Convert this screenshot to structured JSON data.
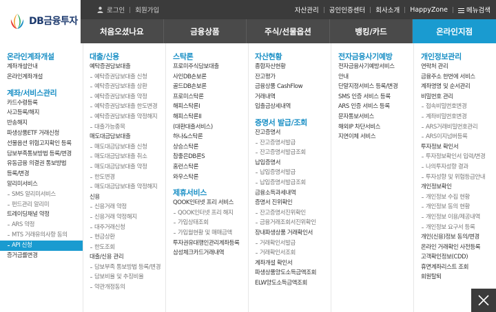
{
  "brand": {
    "name": "DB금융투자",
    "colors": {
      "accent": "#1a9bd0",
      "section": "#1a8fc5",
      "dark": "#3b3b3b",
      "nav": "#4a4a4a"
    }
  },
  "topbar": {
    "login": "로그인",
    "signup": "회원가입",
    "links": [
      "자산관리",
      "공인인증센터",
      "회사소개",
      "HappyZone"
    ],
    "menu_search": "메뉴검색"
  },
  "mainnav": {
    "tabs": [
      "처음오셨나요",
      "금융상품",
      "주식/선물옵션",
      "뱅킹/카드",
      "온라인지점"
    ],
    "active_index": 4
  },
  "columns": [
    {
      "items": [
        {
          "t": "sec",
          "v": "온라인계좌개설"
        },
        {
          "t": "row",
          "v": "계좌개설안내"
        },
        {
          "t": "row",
          "v": "온라인계좌개설"
        },
        {
          "t": "secgap",
          "v": "계좌/서비스관리"
        },
        {
          "t": "row",
          "v": "카드수령등록"
        },
        {
          "t": "row",
          "v": "사고등록/해지"
        },
        {
          "t": "row",
          "v": "반송해지"
        },
        {
          "t": "row",
          "v": "파생상품ETF 거래신청"
        },
        {
          "t": "row",
          "v": "선물옵션 위험고지확인 등록"
        },
        {
          "t": "row",
          "v": "담보부족통보방법 등록/변경"
        },
        {
          "t": "row",
          "v": "유동금융 의결권 통보방법"
        },
        {
          "t": "row",
          "v": "등록/변경"
        },
        {
          "t": "row",
          "v": "알리미서비스"
        },
        {
          "t": "sub",
          "v": "SMS 알리미서비스"
        },
        {
          "t": "sub",
          "v": "펀드관리 알리미"
        },
        {
          "t": "row",
          "v": "트레이딩채널 약정"
        },
        {
          "t": "sub",
          "v": "ARS 약정"
        },
        {
          "t": "sub",
          "v": "MTS 거래유의사항 동의"
        },
        {
          "t": "hl",
          "v": "API 신청"
        },
        {
          "t": "row",
          "v": "증거금률변경"
        }
      ]
    },
    {
      "items": [
        {
          "t": "sec",
          "v": "대출/신용"
        },
        {
          "t": "row",
          "v": "예탁증권담보대출"
        },
        {
          "t": "sub",
          "v": "예탁증권담보대출 신청"
        },
        {
          "t": "sub",
          "v": "예탁증권담보대출 상환"
        },
        {
          "t": "sub",
          "v": "예탁증권담보대출 약정"
        },
        {
          "t": "sub",
          "v": "예탁증권담보대출 한도변경"
        },
        {
          "t": "sub",
          "v": "예탁증권담보대출 약정해지"
        },
        {
          "t": "sub",
          "v": "대출가능종목"
        },
        {
          "t": "row",
          "v": "매도대금담보대출"
        },
        {
          "t": "sub",
          "v": "매도대금담보대출 신청"
        },
        {
          "t": "sub",
          "v": "매도대금담보대출 취소"
        },
        {
          "t": "sub",
          "v": "매도대금담보대출 약정"
        },
        {
          "t": "sub",
          "v": "한도변경"
        },
        {
          "t": "sub",
          "v": "매도대금담보대출 약정해지"
        },
        {
          "t": "row",
          "v": "신용"
        },
        {
          "t": "sub",
          "v": "신용거래 약정"
        },
        {
          "t": "sub",
          "v": "신용거래 약정해지"
        },
        {
          "t": "sub",
          "v": "대주거래신청"
        },
        {
          "t": "sub",
          "v": "현금상환"
        },
        {
          "t": "sub",
          "v": "한도조회"
        },
        {
          "t": "row",
          "v": "대출/신용 관리"
        },
        {
          "t": "sub",
          "v": "담보부족 통보방법 등록/변경"
        },
        {
          "t": "sub",
          "v": "담보비율 및 추징비율"
        },
        {
          "t": "sub",
          "v": "약관개정동의"
        }
      ]
    },
    {
      "items": [
        {
          "t": "sec",
          "v": "스탁론"
        },
        {
          "t": "row",
          "v": "프로미주식담보대출"
        },
        {
          "t": "row",
          "v": "사인DB손보론"
        },
        {
          "t": "row",
          "v": "골드DB손보론"
        },
        {
          "t": "row",
          "v": "프로미스탁론"
        },
        {
          "t": "row",
          "v": "해피스탁론I"
        },
        {
          "t": "row",
          "v": "해피스탁론II"
        },
        {
          "t": "row",
          "v": "(대환대출서비스)"
        },
        {
          "t": "row",
          "v": "하나&스탁론"
        },
        {
          "t": "row",
          "v": "상승스탁론"
        },
        {
          "t": "row",
          "v": "참좋은DB론S"
        },
        {
          "t": "row",
          "v": "홈런스탁론"
        },
        {
          "t": "row",
          "v": "와우스탁론"
        },
        {
          "t": "secgap",
          "v": "제휴서비스"
        },
        {
          "t": "row",
          "v": "QOOK인터넷 프리 서비스"
        },
        {
          "t": "sub",
          "v": "QOOK인터넷 프리 해지"
        },
        {
          "t": "sub",
          "v": "가입상태조회"
        },
        {
          "t": "sub",
          "v": "가입월현황 및 매매금액"
        },
        {
          "t": "row",
          "v": "투자권유대행인관리계좌등록"
        },
        {
          "t": "row",
          "v": "삼성체크카드거래내역"
        }
      ]
    },
    {
      "items": [
        {
          "t": "sec",
          "v": "자산현황"
        },
        {
          "t": "row",
          "v": "종합자산현황"
        },
        {
          "t": "row",
          "v": "잔고평가"
        },
        {
          "t": "row",
          "v": "금융상품 CashFlow"
        },
        {
          "t": "row",
          "v": "거래내역"
        },
        {
          "t": "row",
          "v": "입출금상세내역"
        },
        {
          "t": "secgap",
          "v": "증명서 발급/조회"
        },
        {
          "t": "row",
          "v": "잔고증명서"
        },
        {
          "t": "sub",
          "v": "잔고증명서발급"
        },
        {
          "t": "sub",
          "v": "잔고증명서발급조회"
        },
        {
          "t": "row",
          "v": "납입증명서"
        },
        {
          "t": "sub",
          "v": "납입증명서발급"
        },
        {
          "t": "sub",
          "v": "납입증명서발급조회"
        },
        {
          "t": "row",
          "v": "금융소득과세내역"
        },
        {
          "t": "row",
          "v": "증명서 진위확인"
        },
        {
          "t": "sub",
          "v": "잔고증명서진위확인"
        },
        {
          "t": "sub",
          "v": "금융거래조회서진위확인"
        },
        {
          "t": "row",
          "v": "장내파생상품 거래확인서"
        },
        {
          "t": "sub",
          "v": "거래확인서발급"
        },
        {
          "t": "sub",
          "v": "거래확인서조회"
        },
        {
          "t": "row",
          "v": "계좌개설 확인서"
        },
        {
          "t": "row",
          "v": "파생상품양도소득금액조회"
        },
        {
          "t": "row",
          "v": "ELW양도소득금액조회"
        }
      ]
    },
    {
      "items": [
        {
          "t": "sec",
          "v": "전자금융사기예방"
        },
        {
          "t": "row",
          "v": "전자금융사기예방서비스"
        },
        {
          "t": "row",
          "v": "안내"
        },
        {
          "t": "row",
          "v": "단말지정서비스 등록/변경"
        },
        {
          "t": "row",
          "v": "SMS 인증 서비스 등록"
        },
        {
          "t": "row",
          "v": "ARS 인증 서비스 등록"
        },
        {
          "t": "row",
          "v": "문자통보서비스"
        },
        {
          "t": "row",
          "v": "해외IP 차단서비스"
        },
        {
          "t": "row",
          "v": "지연이체 서비스"
        }
      ]
    },
    {
      "items": [
        {
          "t": "sec",
          "v": "개인정보관리"
        },
        {
          "t": "row",
          "v": "연락처 관리"
        },
        {
          "t": "row",
          "v": "금융주소 한번에 서비스"
        },
        {
          "t": "row",
          "v": "계좌명명 및 순서관리"
        },
        {
          "t": "row",
          "v": "비밀번호 관리"
        },
        {
          "t": "sub",
          "v": "접속비밀번호변경"
        },
        {
          "t": "sub",
          "v": "계좌비밀번호변경"
        },
        {
          "t": "sub",
          "v": "ARS거래비밀번호관리"
        },
        {
          "t": "sub",
          "v": "ARS이지넘버등록"
        },
        {
          "t": "row",
          "v": "투자정보 확인서"
        },
        {
          "t": "sub",
          "v": "투자정보확인서 입력/변경"
        },
        {
          "t": "sub",
          "v": "나의투자성향 결과"
        },
        {
          "t": "sub",
          "v": "투자성향 및 위험등급안내"
        },
        {
          "t": "row",
          "v": "개인정보확인"
        },
        {
          "t": "sub",
          "v": "개인정보 수집 현황"
        },
        {
          "t": "sub",
          "v": "개인정보 동의 현황"
        },
        {
          "t": "sub",
          "v": "개인정보 이용/제공내역"
        },
        {
          "t": "sub",
          "v": "개인정보 요구서 등록"
        },
        {
          "t": "row",
          "v": "개인(신용)정보 동의/변경"
        },
        {
          "t": "row",
          "v": "온라인 거래확인 사전등록"
        },
        {
          "t": "row",
          "v": "고객확인정보(CDD)"
        },
        {
          "t": "row",
          "v": "휴면계좌리스트 조회"
        },
        {
          "t": "row",
          "v": "회원탈퇴"
        }
      ]
    }
  ],
  "close_button": {
    "icon": "close-icon"
  }
}
